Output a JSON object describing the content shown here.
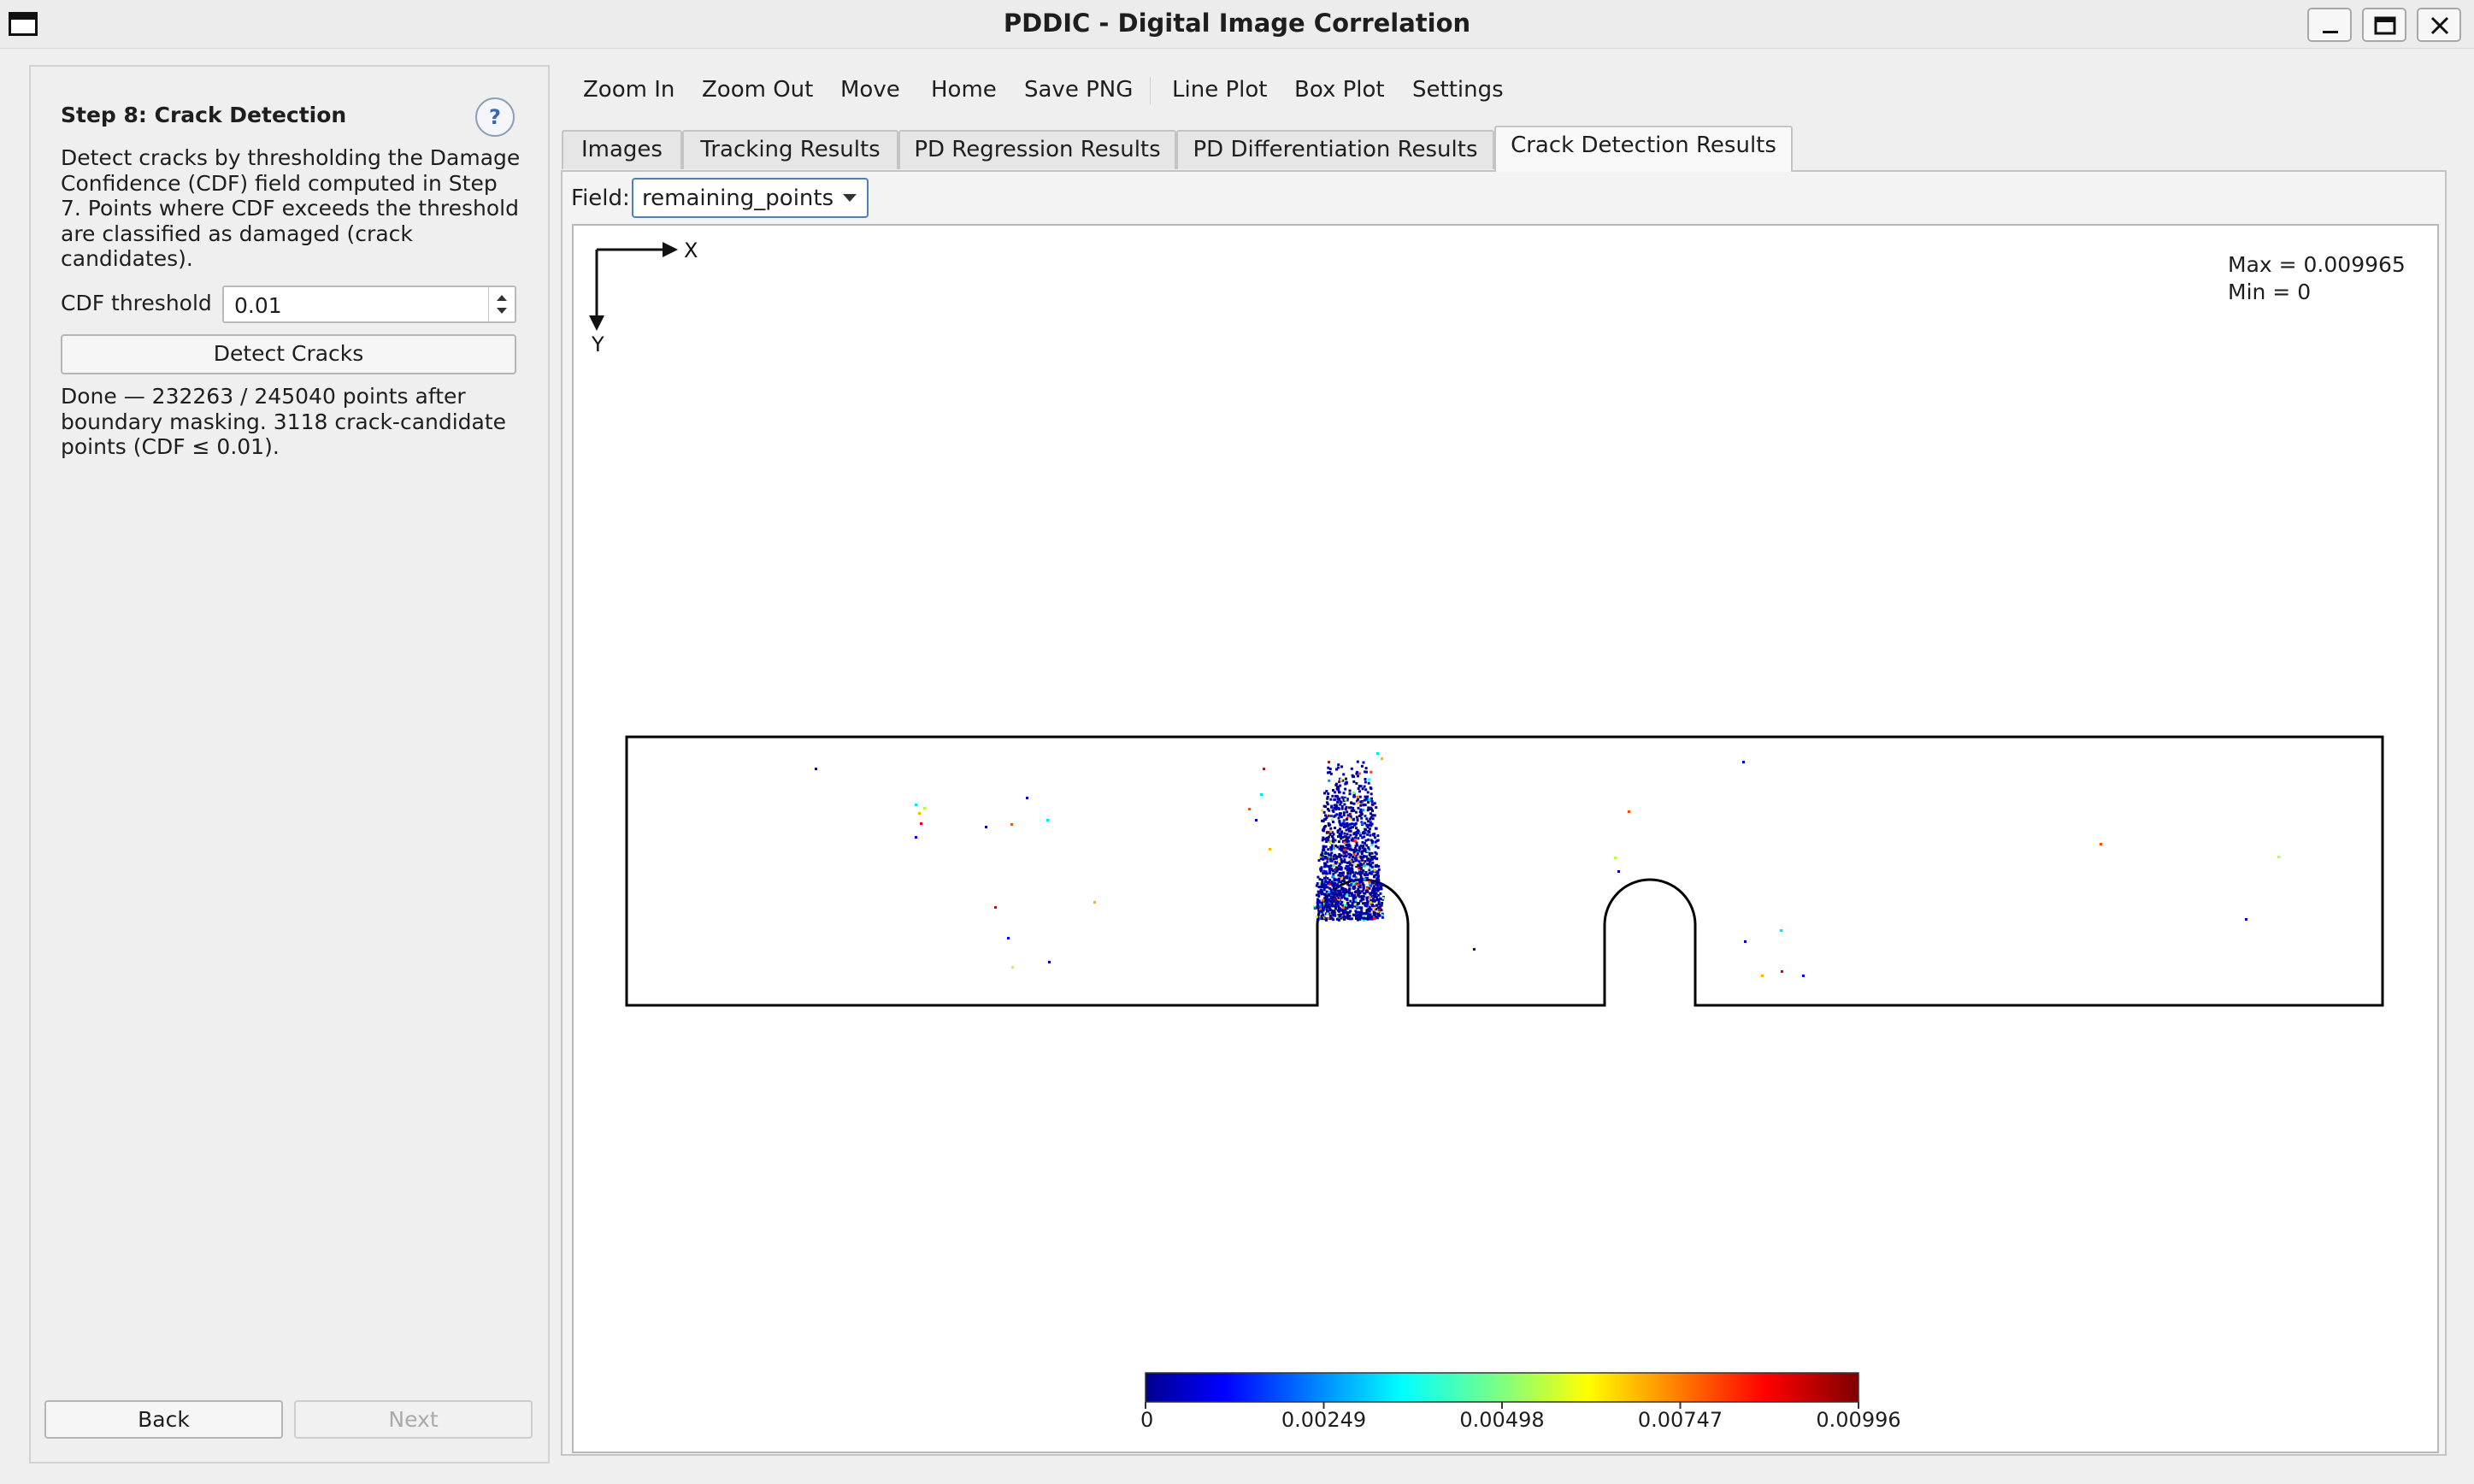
{
  "window": {
    "title": "PDDIC - Digital Image Correlation",
    "controls": [
      "minimize",
      "maximize",
      "close"
    ]
  },
  "left_panel": {
    "step_title": "Step 8: Crack Detection",
    "help_label": "?",
    "description": "Detect cracks by thresholding the Damage Confidence (CDF) field computed in Step 7. Points where CDF exceeds the threshold are classified as damaged (crack candidates).",
    "cdf_label": "CDF threshold",
    "cdf_value": "0.01",
    "detect_button": "Detect Cracks",
    "status": "Done — 232263 / 245040 points after boundary masking. 3118 crack-candidate points (CDF ≤ 0.01).",
    "back_button": "Back",
    "next_button": "Next"
  },
  "toolbar": {
    "zoom_in": "Zoom In",
    "zoom_out": "Zoom Out",
    "move": "Move",
    "home": "Home",
    "save_png": "Save PNG",
    "line_plot": "Line Plot",
    "box_plot": "Box Plot",
    "settings": "Settings"
  },
  "tabs": {
    "images": "Images",
    "tracking": "Tracking Results",
    "pd_regression": "PD Regression Results",
    "pd_differentiation": "PD Differentiation Results",
    "crack_detection": "Crack Detection Results",
    "active": "Crack Detection Results"
  },
  "field": {
    "label": "Field:",
    "value": "remaining_points"
  },
  "plot": {
    "axis_x": "X",
    "axis_y": "Y",
    "max_label": "Max = 0.009965",
    "min_label": "Min = 0",
    "colormap": "jet",
    "colors": {
      "jet_low": "#00008f",
      "jet_high": "#7f0000",
      "outline": "#000000"
    }
  },
  "chart_data": {
    "type": "scatter",
    "title": "",
    "xlabel": "X",
    "ylabel": "Y",
    "colorbar": {
      "ticks": [
        "0",
        "0.00249",
        "0.00498",
        "0.00747",
        "0.00996"
      ],
      "range": [
        0,
        0.009965
      ]
    },
    "value_range": {
      "max": 0.009965,
      "min": 0
    }
  }
}
